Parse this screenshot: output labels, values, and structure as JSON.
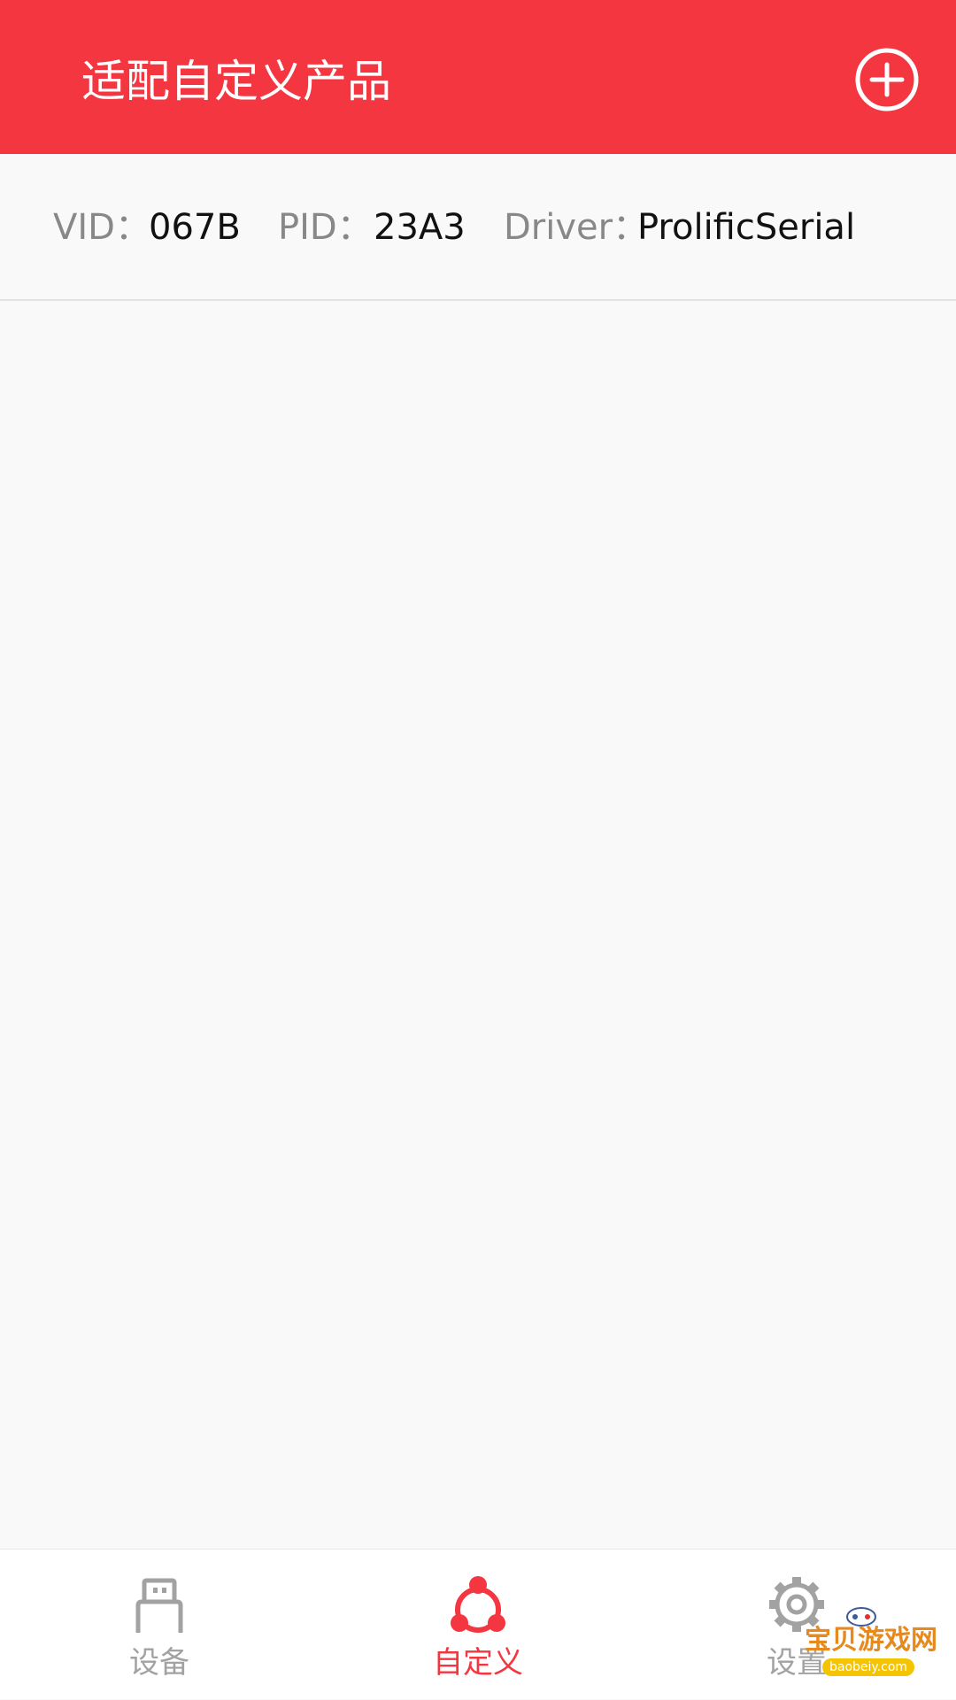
{
  "app_bar": {
    "title": "适配自定义产品",
    "add_icon": "plus-circle-icon"
  },
  "device": {
    "vid_label": "VID：",
    "vid_value": "067B",
    "pid_label": "PID：",
    "pid_value": "23A3",
    "driver_label": "Driver：",
    "driver_value": "ProlificSerial"
  },
  "bottom_nav": {
    "items": [
      {
        "label": "设备",
        "icon": "usb-icon",
        "active": false
      },
      {
        "label": "自定义",
        "icon": "share-nodes-icon",
        "active": true
      },
      {
        "label": "设置",
        "icon": "gear-icon",
        "active": false
      }
    ]
  },
  "watermark": {
    "text": "宝贝游戏网",
    "sub": "baobeiy.com"
  },
  "colors": {
    "accent": "#f43641",
    "inactive": "#a2a2a2",
    "background": "#f9f9f9"
  }
}
